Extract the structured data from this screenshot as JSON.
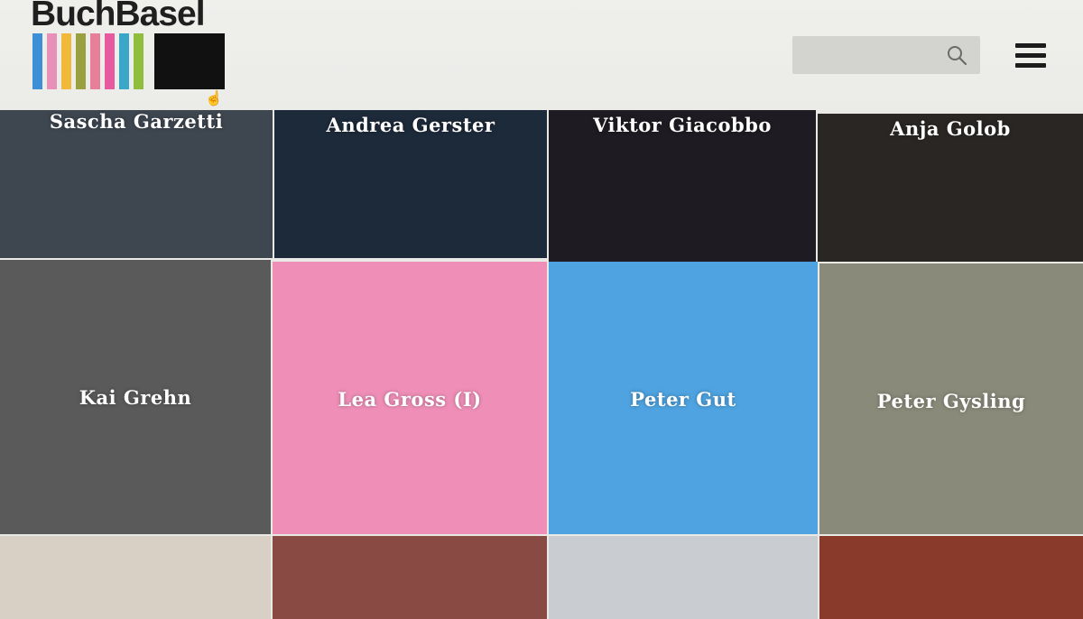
{
  "brand": {
    "name": "BuchBasel",
    "stripe_colors": [
      "#3d8fd6",
      "#e890b8",
      "#f0b93a",
      "#9aa040",
      "#e87f9a",
      "#e85aa0",
      "#3aa6c8",
      "#8fbd3c",
      "#1c1c1c"
    ]
  },
  "header": {
    "search": {
      "placeholder": "",
      "icon": "search-icon"
    },
    "menu_icon": "hamburger-icon"
  },
  "authors_row1": [
    {
      "name": "Sascha Garzetti",
      "bg": "#3e4650"
    },
    {
      "name": "Andrea Gerster",
      "bg": "#1d2a3a"
    },
    {
      "name": "Viktor Giacobbo",
      "bg": "#1e1c22"
    },
    {
      "name": "Anja Golob",
      "bg": "#2a2624"
    }
  ],
  "authors_row2": [
    {
      "name": "Kai Grehn",
      "bg": "#5a5a5a"
    },
    {
      "name": "Lea Gross (I)",
      "bg": "#ef8fb8"
    },
    {
      "name": "Peter Gut",
      "bg": "#4ea3e0"
    },
    {
      "name": "Peter Gysling",
      "bg": "#8a8a7a"
    }
  ],
  "authors_row3": [
    {
      "name": "",
      "bg": "#d8d0c4"
    },
    {
      "name": "",
      "bg": "#8a4a44"
    },
    {
      "name": "",
      "bg": "#c9ccd0"
    },
    {
      "name": "",
      "bg": "#8a3a2a"
    }
  ]
}
